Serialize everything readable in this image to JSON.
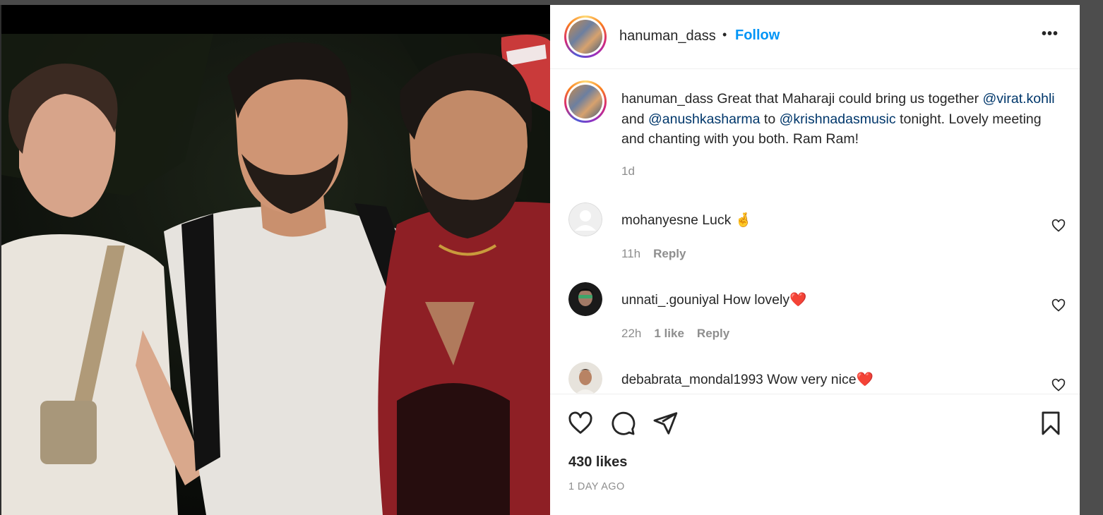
{
  "post": {
    "username": "hanuman_dass",
    "separator": "•",
    "follow_label": "Follow",
    "more_label": "•••",
    "caption": {
      "username": "hanuman_dass",
      "text_1": " Great that Maharaji could bring us together ",
      "mention_1": "@virat.kohli",
      "text_2": " and ",
      "mention_2": "@anushkasharma",
      "text_3": " to ",
      "mention_3": "@krishnadasmusic",
      "text_4": " tonight. Lovely meeting and chanting with you both. Ram Ram!",
      "age": "1d"
    },
    "comments": [
      {
        "username": "mohanyesne",
        "text": " Luck ",
        "emoji": "🤞",
        "time": "11h",
        "likes": "",
        "reply": "Reply",
        "avatar": "default"
      },
      {
        "username": "unnati_.gouniyal",
        "text": " How lovely",
        "emoji": "❤️",
        "time": "22h",
        "likes": "1 like",
        "reply": "Reply",
        "avatar": "photo-dark"
      },
      {
        "username": "debabrata_mondal1993",
        "text": " Wow very nice",
        "emoji": "❤️",
        "time": "",
        "likes": "",
        "reply": "",
        "avatar": "photo-light"
      }
    ],
    "likes_count": "430 likes",
    "posted_ago": "1 DAY AGO"
  },
  "icons": {
    "like": "heart-outline",
    "comment": "speech-bubble",
    "share": "paper-plane",
    "save": "bookmark",
    "comment_like": "small-heart"
  },
  "colors": {
    "follow": "#0095f6",
    "mention": "#00376b",
    "muted": "#8e8e8e",
    "heart_emoji": "#e0245e"
  }
}
